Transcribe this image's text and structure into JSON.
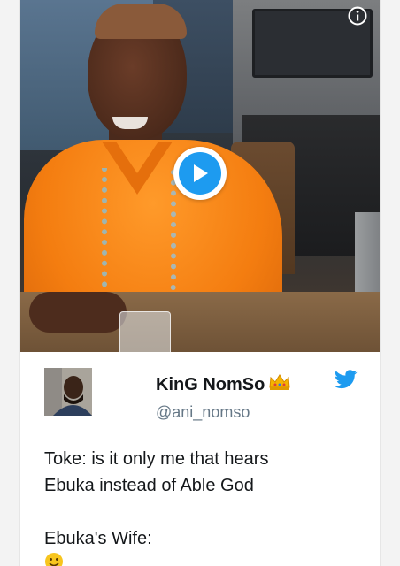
{
  "media": {
    "type": "video",
    "play_button_icon": "play-icon",
    "info_icon": "info-icon",
    "accent_color": "#1d9bf0"
  },
  "tweet": {
    "display_name": "KinG NomSo",
    "name_badge_icon": "crown-icon",
    "handle": "@ani_nomso",
    "platform_icon": "twitter-bird-icon",
    "lines": [
      "Toke: is it only me that hears",
      "Ebuka instead of Able God",
      "",
      "Ebuka's Wife:"
    ],
    "trailing_emoji_icon": "emoji-icon"
  }
}
